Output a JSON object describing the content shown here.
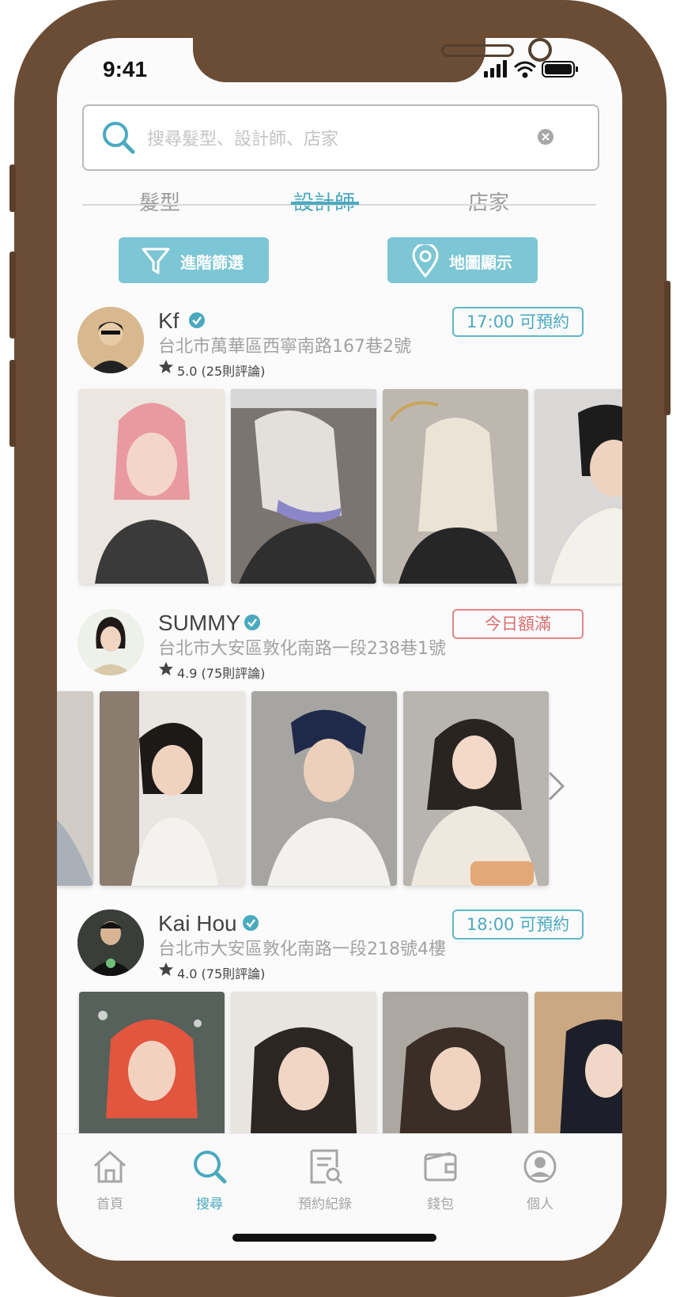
{
  "status_bar": {
    "time": "9:41"
  },
  "search": {
    "placeholder": "搜尋髮型、設計師、店家"
  },
  "tabs": [
    {
      "label": "髮型",
      "active": false
    },
    {
      "label": "設計師",
      "active": true
    },
    {
      "label": "店家",
      "active": false
    }
  ],
  "actions": {
    "filter_label": "進階篩選",
    "map_label": "地圖顯示"
  },
  "designers": [
    {
      "name": "Kf",
      "address": "台北市萬華區西寧南路167巷2號",
      "rating": "5.0",
      "reviews": "(25則評論)",
      "status": "17:00 可預約",
      "status_type": "available"
    },
    {
      "name": "SUMMY",
      "address": "台北市大安區敦化南路一段238巷1號",
      "rating": "4.9",
      "reviews": "(75則評論)",
      "status": "今日額滿",
      "status_type": "full"
    },
    {
      "name": "Kai Hou",
      "address": "台北市大安區敦化南路一段218號4樓",
      "rating": "4.0",
      "reviews": "(75則評論)",
      "status": "18:00 可預約",
      "status_type": "available"
    }
  ],
  "bottom_nav": [
    {
      "label": "首頁",
      "icon": "home-icon",
      "active": false
    },
    {
      "label": "搜尋",
      "icon": "search-icon",
      "active": true
    },
    {
      "label": "預約紀錄",
      "icon": "booking-record-icon",
      "active": false
    },
    {
      "label": "錢包",
      "icon": "wallet-icon",
      "active": false
    },
    {
      "label": "個人",
      "icon": "profile-icon",
      "active": false
    }
  ],
  "colors": {
    "accent": "#4aa9bf",
    "button_bg": "#7cc6d5",
    "full_red": "#d96f6f",
    "frame": "#6b4c35"
  }
}
